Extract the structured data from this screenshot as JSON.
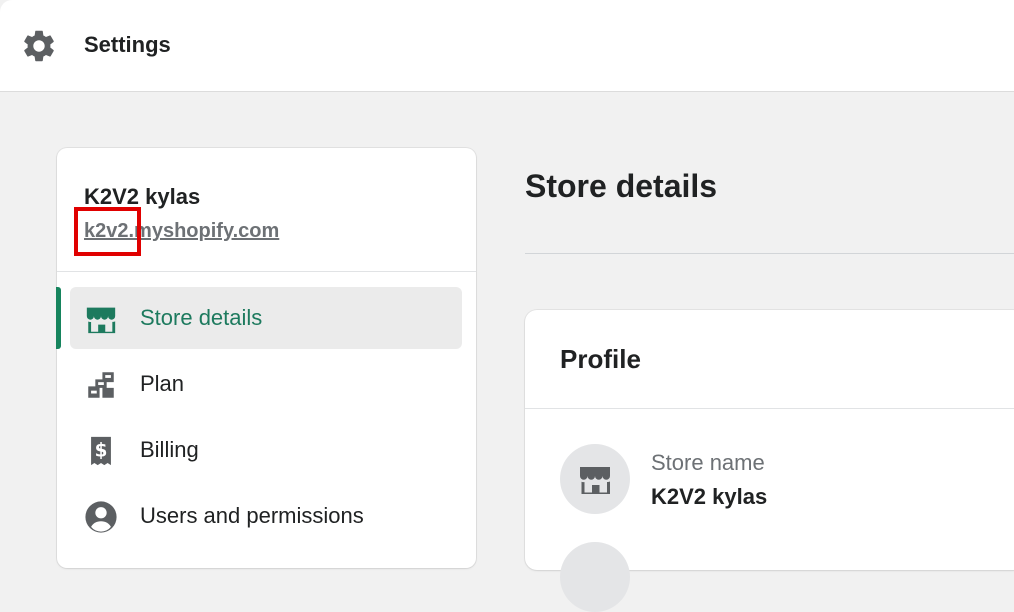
{
  "header": {
    "title": "Settings",
    "icon": "gear-icon"
  },
  "sidebar": {
    "store_name": "K2V2 kylas",
    "store_domain": "k2v2.myshopify.com",
    "items": [
      {
        "label": "Store details",
        "icon": "store-icon",
        "active": true
      },
      {
        "label": "Plan",
        "icon": "plan-icon",
        "active": false
      },
      {
        "label": "Billing",
        "icon": "billing-icon",
        "active": false
      },
      {
        "label": "Users and permissions",
        "icon": "user-icon",
        "active": false
      }
    ]
  },
  "main": {
    "page_title": "Store details",
    "profile_card": {
      "title": "Profile",
      "fields": [
        {
          "label": "Store name",
          "value": "K2V2 kylas",
          "icon": "store-icon"
        }
      ]
    }
  },
  "colors": {
    "accent": "#1d7a5e",
    "highlight": "#e00000",
    "icon": "#5c5f62"
  }
}
